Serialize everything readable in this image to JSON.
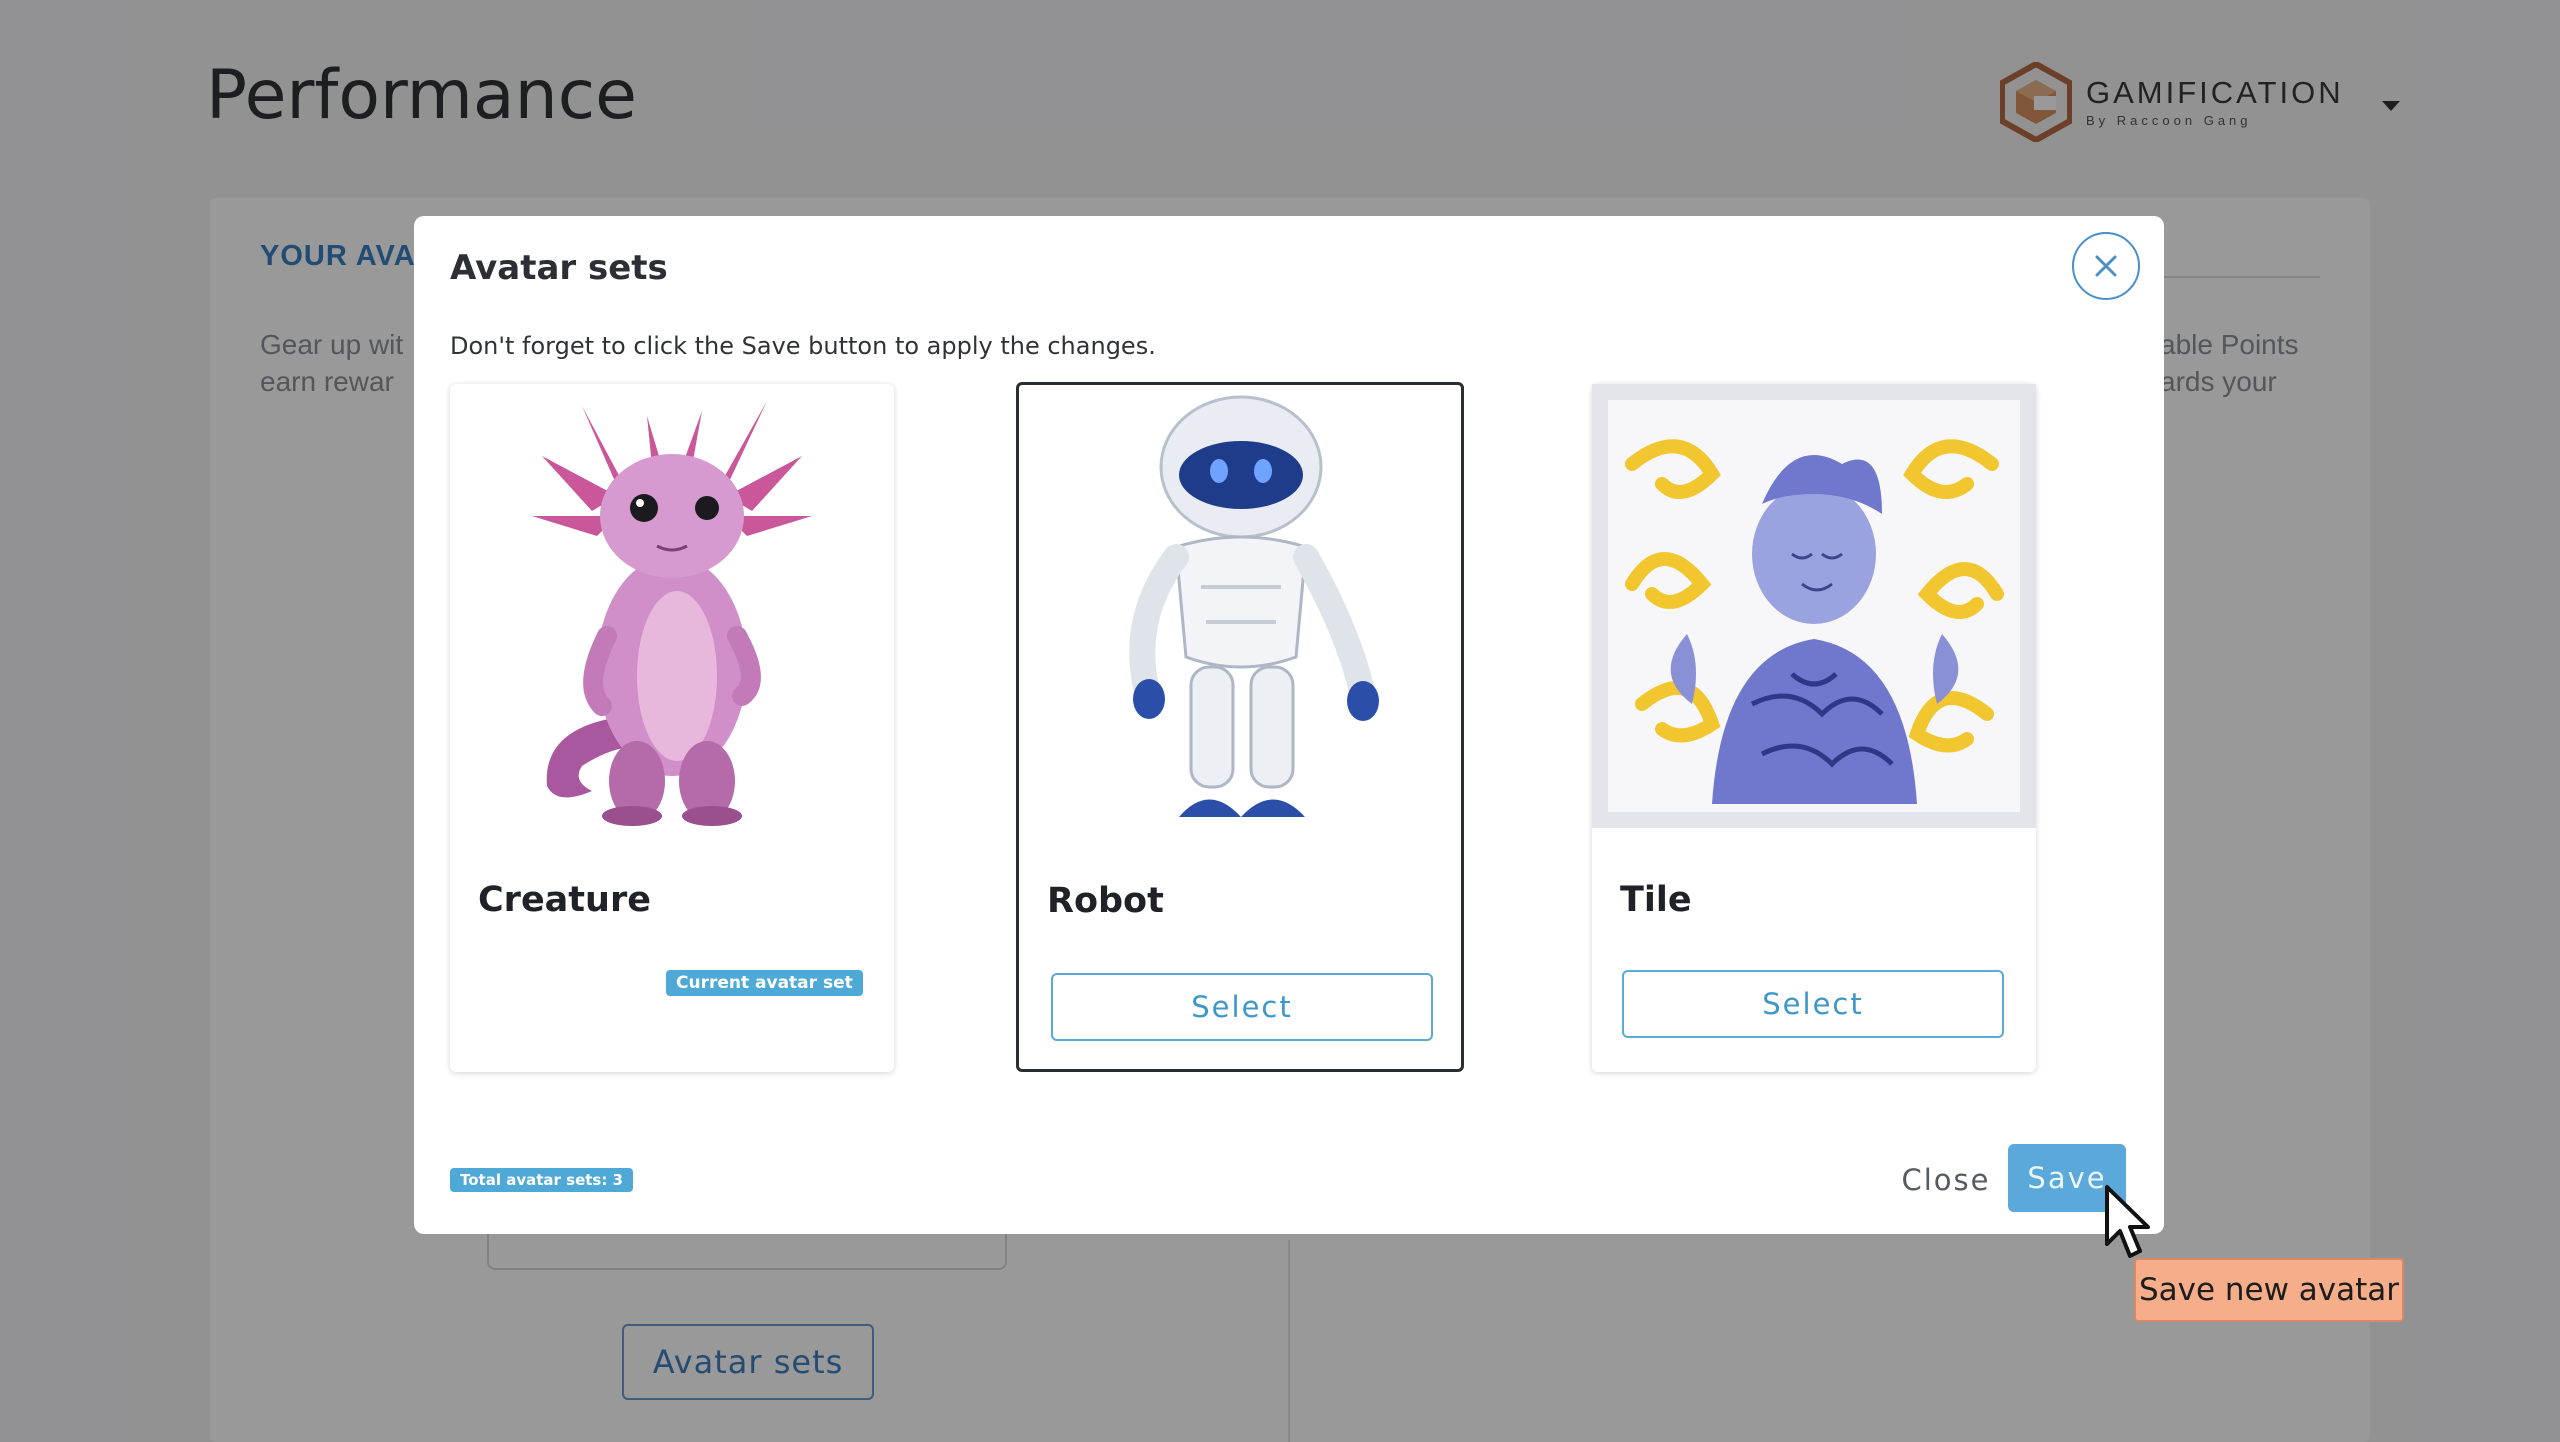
{
  "page": {
    "title": "Performance",
    "brand": {
      "name": "GAMIFICATION",
      "subtitle": "By Raccoon Gang"
    },
    "section_heading": "YOUR AVA",
    "desc_left": "Gear up wit\nearn rewar",
    "desc_right": "able Points\nards your",
    "avatar_sets_button": "Avatar sets"
  },
  "modal": {
    "title": "Avatar sets",
    "hint": "Don't forget to click the Save button to apply the changes.",
    "cards": [
      {
        "name": "Creature",
        "badge": "Current avatar set",
        "icon": "axolotl-creature-image"
      },
      {
        "name": "Robot",
        "button": "Select",
        "icon": "robot-image",
        "selected": true
      },
      {
        "name": "Tile",
        "button": "Select",
        "icon": "tile-portrait-image"
      }
    ],
    "total_badge": "Total avatar sets: 3",
    "close_label": "Close",
    "save_label": "Save"
  },
  "tooltip": {
    "text": "Save new avatar"
  },
  "colors": {
    "accent": "#4fa9d6",
    "tooltip_bg": "#f5ad8a",
    "overlay": "rgba(0,0,0,0.40)"
  }
}
